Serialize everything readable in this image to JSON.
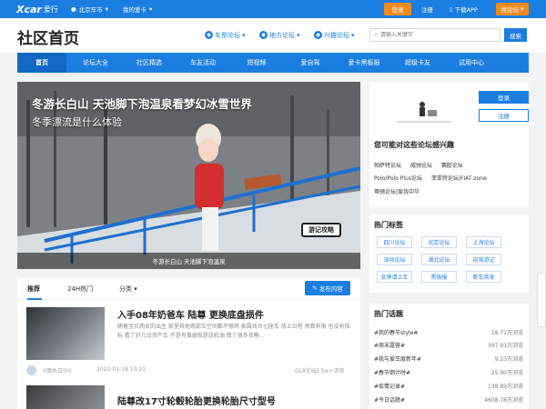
{
  "topbar": {
    "logo_main": "Xcar",
    "logo_sub": "爱行",
    "location": "北京车市",
    "my_car": "我的爱卡",
    "login": "登录",
    "register": "注册",
    "download_app": "下载APP",
    "find_forum": "找论坛"
  },
  "header": {
    "title": "社区首页",
    "selectors": [
      "车型论坛",
      "地方论坛",
      "兴趣论坛"
    ],
    "search_placeholder": "请输入关键字",
    "search_button": "搜索"
  },
  "nav": [
    "首页",
    "论坛大全",
    "社区精选",
    "车友活动",
    "短视频",
    "爱自驾",
    "爱卡黑板报",
    "超级卡友",
    "试用中心"
  ],
  "banner": {
    "headline": "冬游长白山 天池脚下泡温泉看梦幻冰雪世界",
    "subline": "冬季漂流是什么体验",
    "tag": "游记攻略",
    "caption": "冬游长白山 天池脚下泡温泉"
  },
  "feed": {
    "tabs": [
      "推荐",
      "24H热门",
      "分类"
    ],
    "publish": "发布内容",
    "posts": [
      {
        "title": "入手08年奶爸车 陆尊 更换底盘损件",
        "desc": "随着宝贝两女的出生 家里其他两部车空间都不够用 家属找台七座车 放上日程 预算有限 也没有指标 看了好几台资产车 不是有事故就是烧机油 做了很多攻略...",
        "author": "0丽水白沙0",
        "time": "2021-01-18 10:21",
        "forum": "GL8论坛",
        "views": "3.5w+浏览"
      },
      {
        "title": "陆尊改17寸轮毂轮胎更换轮胎尺寸型号"
      }
    ]
  },
  "sidebar": {
    "login": "登录",
    "register": "注册",
    "interest_title": "您可能对这些论坛感兴趣",
    "interest_rows": [
      [
        "帕萨特论坛",
        "威驰论坛",
        "赛欧论坛"
      ],
      [
        "Polo/Polo Plus论坛",
        "菲亚特论坛|FIAT zone"
      ],
      [
        "尊驰论坛|爱我中华"
      ]
    ],
    "tags_title": "热门标签",
    "tags": [
      "四川论坛",
      "北京论坛",
      "上海论坛",
      "深圳论坛",
      "湖北论坛",
      "自驾游记",
      "女神请上车",
      "黑板报",
      "新车首发"
    ],
    "topics_title": "热门话题",
    "topics": [
      {
        "name": "#我的春节style#",
        "views": "18.71万浏览"
      },
      {
        "name": "#周末露营#",
        "views": "397.93万浏览"
      },
      {
        "name": "#我与爱车度新年#",
        "views": "9.23万浏览"
      },
      {
        "name": "#春节倒计时#",
        "views": "25.90万浏览"
      },
      {
        "name": "#疫情记录#",
        "views": "138.89万浏览"
      },
      {
        "name": "#今日话题#",
        "views": "4608.78万浏览"
      }
    ]
  }
}
